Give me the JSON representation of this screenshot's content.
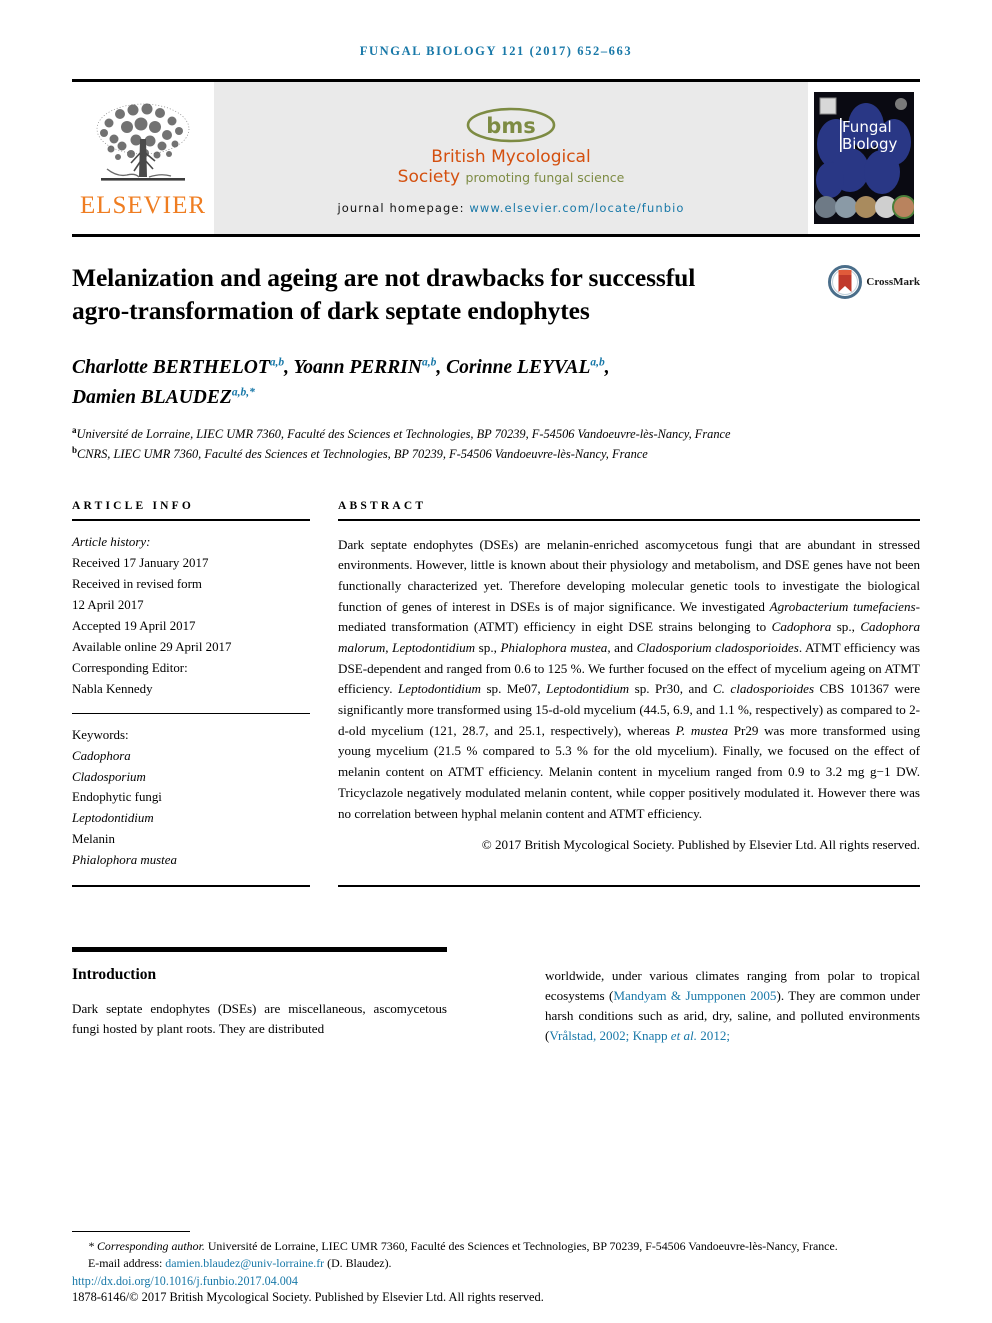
{
  "running_head": "Fungal Biology 121 (2017) 652–663",
  "masthead": {
    "publisher_name": "ELSEVIER",
    "publisher_logo_icon": "elsevier-tree-icon",
    "society_logo_icon": "bms-ellipse-logo",
    "society_logo_text": "bms",
    "society_name_line1": "British Mycological",
    "society_name_line2": "Society",
    "society_tagline": "promoting fungal science",
    "homepage_label": "journal homepage:",
    "homepage_url": "www.elsevier.com/locate/funbio",
    "cover_title_line1": "Fungal",
    "cover_title_line2": "Biology",
    "cover_icon": "journal-cover-thumbnail"
  },
  "article": {
    "title": "Melanization and ageing are not drawbacks for successful agro-transformation of dark septate endophytes",
    "crossmark_label": "CrossMark",
    "crossmark_icon": "crossmark-badge-icon",
    "authors": [
      {
        "name": "Charlotte BERTHELOT",
        "sup": "a,b",
        "sep": ", "
      },
      {
        "name": "Yoann PERRIN",
        "sup": "a,b",
        "sep": ", "
      },
      {
        "name": "Corinne LEYVAL",
        "sup": "a,b",
        "sep": ", "
      },
      {
        "name": "Damien BLAUDEZ",
        "sup": "a,b,*",
        "sep": ""
      }
    ],
    "affiliations": [
      {
        "marker": "a",
        "text": "Université de Lorraine, LIEC UMR 7360, Faculté des Sciences et Technologies, BP 70239, F-54506 Vandoeuvre-lès-Nancy, France"
      },
      {
        "marker": "b",
        "text": "CNRS, LIEC UMR 7360, Faculté des Sciences et Technologies, BP 70239, F-54506 Vandoeuvre-lès-Nancy, France"
      }
    ]
  },
  "article_info": {
    "heading": "ARTICLE INFO",
    "history_label": "Article history:",
    "history": [
      "Received 17 January 2017",
      "Received in revised form",
      "12 April 2017",
      "Accepted 19 April 2017",
      "Available online 29 April 2017"
    ],
    "editor_label": "Corresponding Editor:",
    "editor_name": "Nabla Kennedy",
    "keywords_label": "Keywords:",
    "keywords": [
      "Cadophora",
      "Cladosporium",
      "Endophytic fungi",
      "Leptodontidium",
      "Melanin",
      "Phialophora mustea"
    ]
  },
  "abstract": {
    "heading": "ABSTRACT",
    "paragraphs": [
      "Dark septate endophytes (DSEs) are melanin-enriched ascomycetous fungi that are abundant in stressed environments. However, little is known about their physiology and metabolism, and DSE genes have not been functionally characterized yet. Therefore developing molecular genetic tools to investigate the biological function of genes of interest in DSEs is of major significance. We investigated Agrobacterium tumefaciens-mediated transformation (ATMT) efficiency in eight DSE strains belonging to Cadophora sp., Cadophora malorum, Leptodontidium sp., Phialophora mustea, and Cladosporium cladosporioides. ATMT efficiency was DSE-dependent and ranged from 0.6 to 125 %. We further focused on the effect of mycelium ageing on ATMT efficiency. Leptodontidium sp. Me07, Leptodontidium sp. Pr30, and C. cladosporioides CBS 101367 were significantly more transformed using 15-d-old mycelium (44.5, 6.9, and 1.1 %, respectively) as compared to 2-d-old mycelium (121, 28.7, and 25.1, respectively), whereas P. mustea Pr29 was more transformed using young mycelium (21.5 % compared to 5.3 % for the old mycelium). Finally, we focused on the effect of melanin content on ATMT efficiency. Melanin content in mycelium ranged from 0.9 to 3.2 mg g−1 DW. Tricyclazole negatively modulated melanin content, while copper positively modulated it. However there was no correlation between hyphal melanin content and ATMT efficiency."
    ],
    "copyright": "© 2017 British Mycological Society. Published by Elsevier Ltd. All rights reserved."
  },
  "introduction": {
    "title": "Introduction",
    "left_paragraph": "Dark septate endophytes (DSEs) are miscellaneous, ascomycetous fungi hosted by plant roots. They are distributed",
    "right_paragraph_parts": {
      "p1": "worldwide, under various climates ranging from polar to tropical ecosystems (",
      "cite1": "Mandyam & Jumpponen 2005",
      "p2": "). They are common under harsh conditions such as arid, dry, saline, and polluted environments (",
      "cite2": "Vrålstad, 2002; Knapp ",
      "cite2_italic": "et al.",
      "cite2_end": " 2012;"
    }
  },
  "footnote": {
    "corresponding_marker": "*",
    "corresponding_label": "Corresponding author.",
    "corresponding_address": " Université de Lorraine, LIEC UMR 7360, Faculté des Sciences et Technologies, BP 70239, F-54506 Vandoeuvre-lès-Nancy, France.",
    "email_label": "E-mail address:",
    "email": "damien.blaudez@univ-lorraine.fr",
    "email_suffix": "(D. Blaudez).",
    "doi": "http://dx.doi.org/10.1016/j.funbio.2017.04.004",
    "issn_line": "1878-6146/© 2017 British Mycological Society. Published by Elsevier Ltd. All rights reserved."
  },
  "colors": {
    "link_blue": "#1878a8",
    "elsevier_orange": "#ef7d21",
    "bms_orange": "#d4500f",
    "bms_olive": "#7d8b43",
    "band_gray": "#eaeaea"
  }
}
